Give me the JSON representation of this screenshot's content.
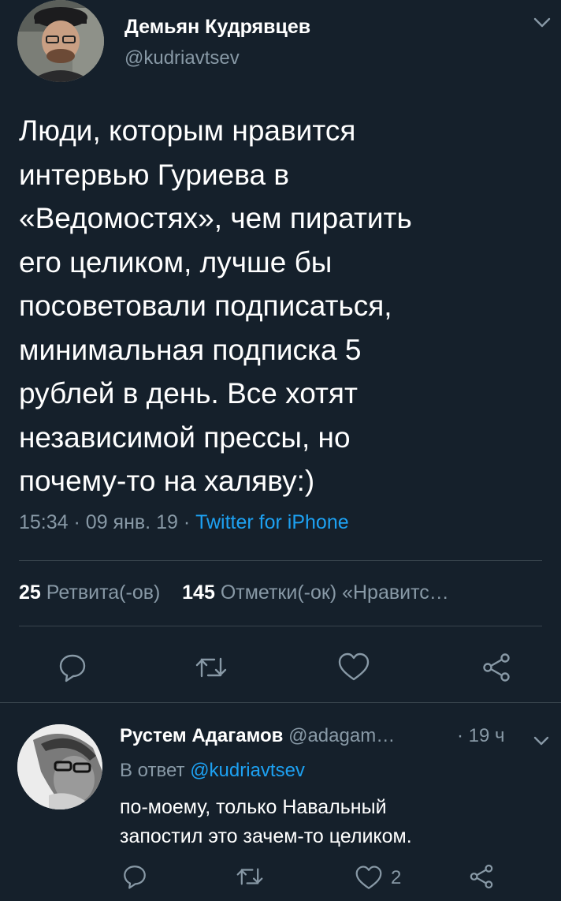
{
  "colors": {
    "background": "#15202b",
    "text_primary": "#ffffff",
    "text_secondary": "#8899a6",
    "accent": "#1da1f2",
    "divider": "#38444d"
  },
  "tweet": {
    "author_name": "Демьян Кудрявцев",
    "author_handle": "@kudriavtsev",
    "text_lines": [
      "Люди, которым нравится",
      "интервью Гуриева в",
      "«Ведомостях», чем пиратить",
      "его целиком, лучше бы",
      "посоветовали подписаться,",
      "минимальная подписка 5",
      "рублей в день. Все хотят",
      "независимой прессы, но",
      "почему-то на халяву:)"
    ],
    "time": "15:34",
    "date": "09 янв. 19",
    "separator": "·",
    "source": "Twitter for iPhone",
    "retweets_count": "25",
    "retweets_label": "Ретвита(-ов)",
    "likes_count": "145",
    "likes_label": "Отметки(-ок) «Нравитс…",
    "icons": {
      "menu": "chevron-down-icon",
      "reply": "reply-icon",
      "retweet": "retweet-icon",
      "like": "heart-icon",
      "share": "share-icon"
    }
  },
  "reply": {
    "author_name": "Рустем Адагамов",
    "author_handle": "@adagam…",
    "time": "19 ч",
    "separator": "·",
    "in_reply_prefix": "В ответ",
    "in_reply_mention": "@kudriavtsev",
    "text_lines": [
      "по-моему, только Навальный",
      "запостил это зачем-то целиком."
    ],
    "like_count": "2"
  }
}
